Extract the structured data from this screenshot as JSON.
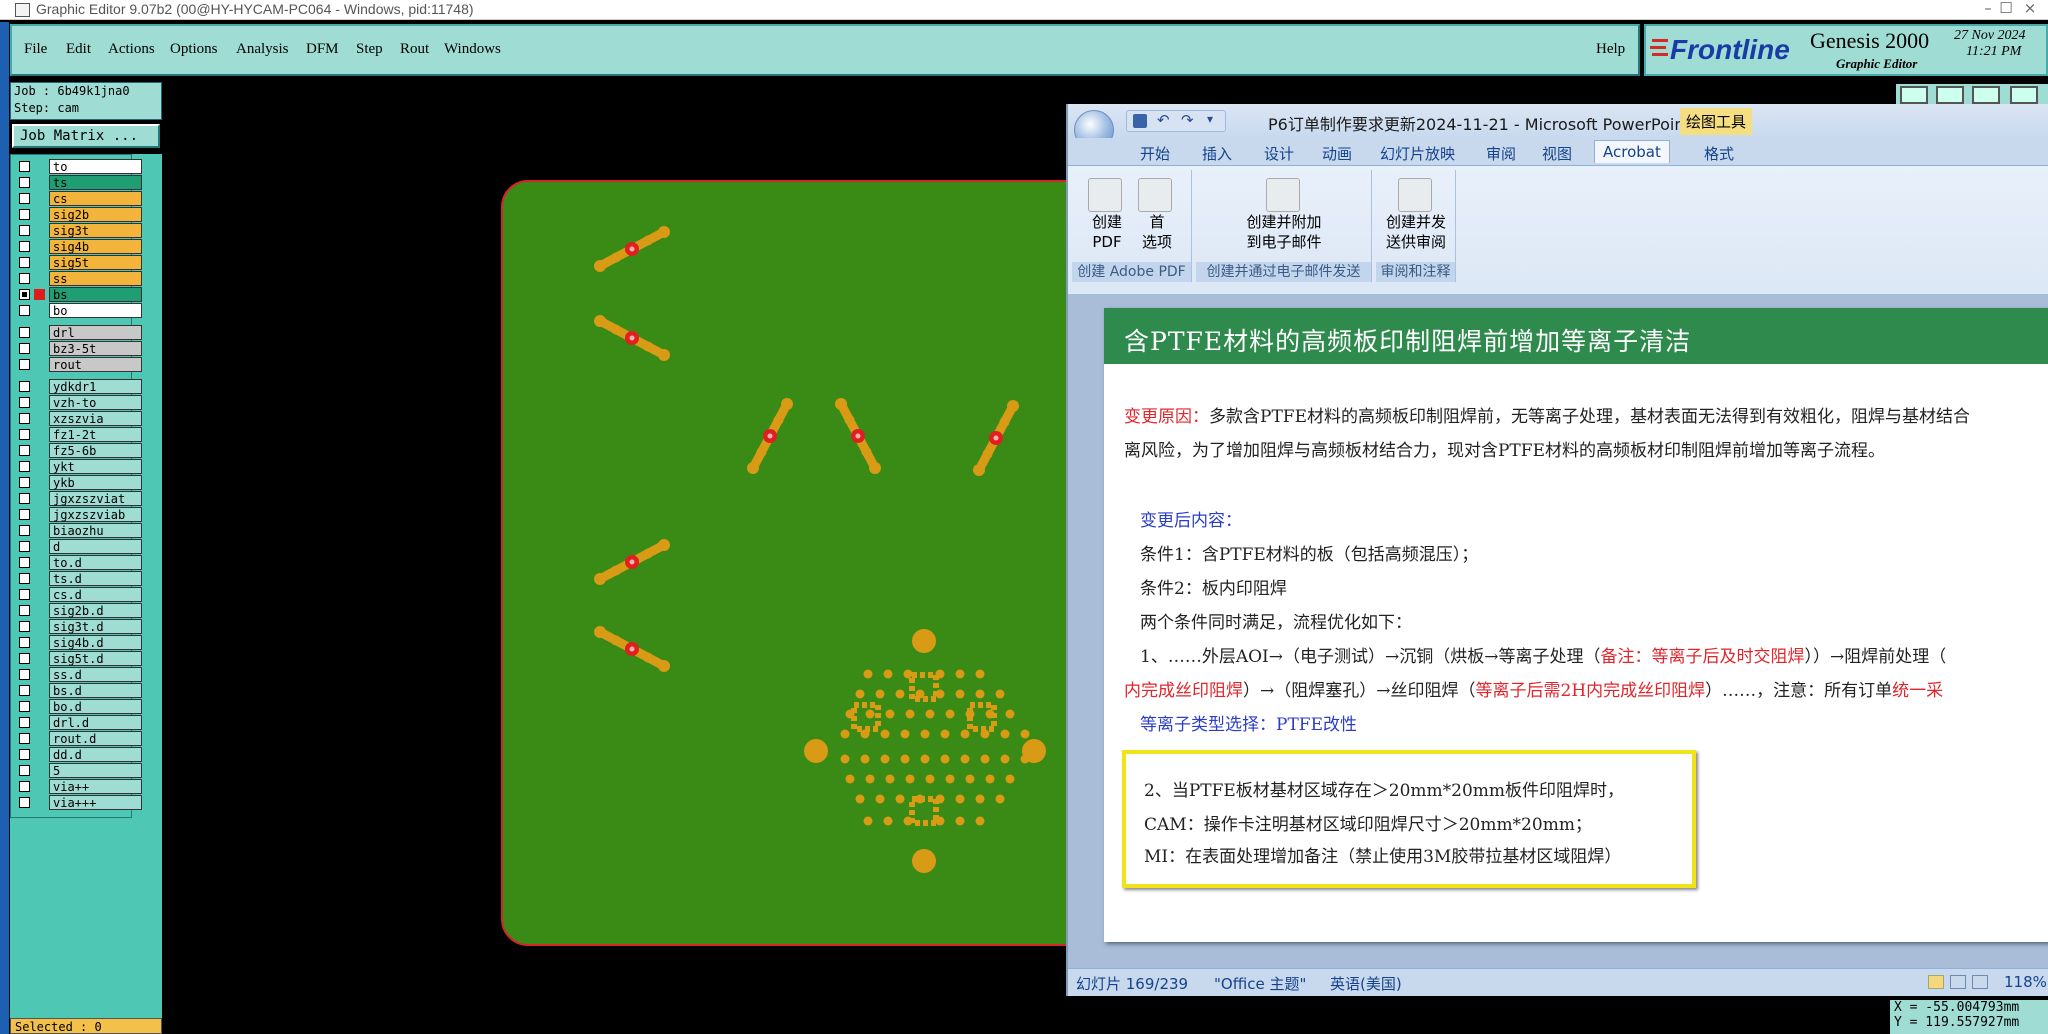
{
  "window": {
    "title": "Graphic Editor 9.07b2 (00@HY-HYCAM-PC064 - Windows, pid:11748)",
    "controls": [
      "–",
      "☐",
      "×"
    ]
  },
  "menubar": {
    "items": [
      "File",
      "Edit",
      "Actions",
      "Options",
      "Analysis",
      "DFM",
      "Step",
      "Rout",
      "Windows"
    ],
    "help": "Help"
  },
  "logo": {
    "brand": "Frontline",
    "product": "Genesis 2000",
    "subtitle": "Graphic Editor",
    "date": "27 Nov 2024",
    "time": "11:21 PM"
  },
  "job": {
    "job_line": "Job : 6b49k1jna0",
    "step_line": "Step: cam",
    "matrix_button": "Job Matrix ..."
  },
  "layers": [
    {
      "name": "to",
      "color": "#ffffff",
      "on": false
    },
    {
      "name": "ts",
      "color": "#1f9e74",
      "on": false
    },
    {
      "name": "cs",
      "color": "#f3b43c",
      "on": false
    },
    {
      "name": "sig2b",
      "color": "#f3b43c",
      "on": false
    },
    {
      "name": "sig3t",
      "color": "#f3b43c",
      "on": false
    },
    {
      "name": "sig4b",
      "color": "#f3b43c",
      "on": false
    },
    {
      "name": "sig5t",
      "color": "#f3b43c",
      "on": false
    },
    {
      "name": "ss",
      "color": "#f3b43c",
      "on": false
    },
    {
      "name": "bs",
      "color": "#1f9e74",
      "on": true
    },
    {
      "name": "bo",
      "color": "#ffffff",
      "on": false
    },
    {
      "name": "drl",
      "color": "#c8c8c8",
      "on": false
    },
    {
      "name": "bz3-5t",
      "color": "#c8c8c8",
      "on": false
    },
    {
      "name": "rout",
      "color": "#c8c8c8",
      "on": false
    },
    {
      "name": "ydkdr1",
      "color": "#9edcd4",
      "on": false
    },
    {
      "name": "vzh-to",
      "color": "#9edcd4",
      "on": false
    },
    {
      "name": "xzszvia",
      "color": "#9edcd4",
      "on": false
    },
    {
      "name": "fz1-2t",
      "color": "#9edcd4",
      "on": false
    },
    {
      "name": "fz5-6b",
      "color": "#9edcd4",
      "on": false
    },
    {
      "name": "ykt",
      "color": "#9edcd4",
      "on": false
    },
    {
      "name": "ykb",
      "color": "#9edcd4",
      "on": false
    },
    {
      "name": "jgxzszviat",
      "color": "#9edcd4",
      "on": false
    },
    {
      "name": "jgxzszviab",
      "color": "#9edcd4",
      "on": false
    },
    {
      "name": "biaozhu",
      "color": "#9edcd4",
      "on": false
    },
    {
      "name": "d",
      "color": "#9edcd4",
      "on": false
    },
    {
      "name": "to.d",
      "color": "#9edcd4",
      "on": false
    },
    {
      "name": "ts.d",
      "color": "#9edcd4",
      "on": false
    },
    {
      "name": "cs.d",
      "color": "#9edcd4",
      "on": false
    },
    {
      "name": "sig2b.d",
      "color": "#9edcd4",
      "on": false
    },
    {
      "name": "sig3t.d",
      "color": "#9edcd4",
      "on": false
    },
    {
      "name": "sig4b.d",
      "color": "#9edcd4",
      "on": false
    },
    {
      "name": "sig5t.d",
      "color": "#9edcd4",
      "on": false
    },
    {
      "name": "ss.d",
      "color": "#9edcd4",
      "on": false
    },
    {
      "name": "bs.d",
      "color": "#9edcd4",
      "on": false
    },
    {
      "name": "bo.d",
      "color": "#9edcd4",
      "on": false
    },
    {
      "name": "drl.d",
      "color": "#9edcd4",
      "on": false
    },
    {
      "name": "rout.d",
      "color": "#9edcd4",
      "on": false
    },
    {
      "name": "dd.d",
      "color": "#9edcd4",
      "on": false
    },
    {
      "name": "5",
      "color": "#9edcd4",
      "on": false
    },
    {
      "name": "via++",
      "color": "#9edcd4",
      "on": false
    },
    {
      "name": "via+++",
      "color": "#9edcd4",
      "on": false
    }
  ],
  "selected": "Selected : 0",
  "coords": {
    "x": "X = -55.004793mm",
    "y": "Y = 119.557927mm"
  },
  "ppt": {
    "title": "P6订单制作要求更新2024-11-21 - Microsoft PowerPoint",
    "context_tab": "绘图工具",
    "tabs": [
      "开始",
      "插入",
      "设计",
      "动画",
      "幻灯片放映",
      "审阅",
      "视图",
      "Acrobat",
      "格式"
    ],
    "active_tab": "Acrobat",
    "ribbon_groups": [
      {
        "label": "创建 Adobe PDF",
        "buttons": [
          "创建\nPDF",
          "首\n选项"
        ]
      },
      {
        "label": "创建并通过电子邮件发送",
        "buttons": [
          "创建并附加\n到电子邮件"
        ]
      },
      {
        "label": "审阅和注释",
        "buttons": [
          "创建并发\n送供审阅"
        ]
      }
    ],
    "slide": {
      "title": "含PTFE材料的高频板印制阻焊前增加等离子清洁",
      "reason_label": "变更原因：",
      "reason_text": "多款含PTFE材料的高频板印制阻焊前，无等离子处理，基材表面无法得到有效粗化，阻焊与基材结合",
      "reason_text2": "离风险，为了增加阻焊与高频板材结合力，现对含PTFE材料的高频板材印制阻焊前增加等离子流程。",
      "after_label": "变更后内容：",
      "cond1": "条件1：含PTFE材料的板（包括高频混压）；",
      "cond2": "条件2：板内印阻焊",
      "both": "两个条件同时满足，流程优化如下：",
      "flow1a": "1、……外层AOI→（电子测试）→沉铜（烘板→等离子处理（",
      "flow1_note": "备注：等离子后及时交阻焊",
      "flow1b": "））→阻焊前处理（",
      "flow2_red": "内完成丝印阻焊",
      "flow2a": "）→（阻焊塞孔）→丝印阻焊（",
      "flow2_note": "等离子后需2H内完成丝印阻焊",
      "flow2b": "）……，注意：所有订单",
      "flow2_tail": "统一采",
      "plasma": "等离子类型选择：PTFE改性",
      "box_line1": "2、当PTFE板材基材区域存在＞20mm*20mm板件印阻焊时，",
      "box_line2": "CAM：操作卡注明基材区域印阻焊尺寸＞20mm*20mm；",
      "box_line3": "MI：在表面处理增加备注（禁止使用3M胶带拉基材区域阻焊）"
    },
    "status": {
      "slide": "幻灯片 169/239",
      "theme": "\"Office 主题\"",
      "lang": "英语(美国)",
      "zoom": "118%"
    }
  }
}
